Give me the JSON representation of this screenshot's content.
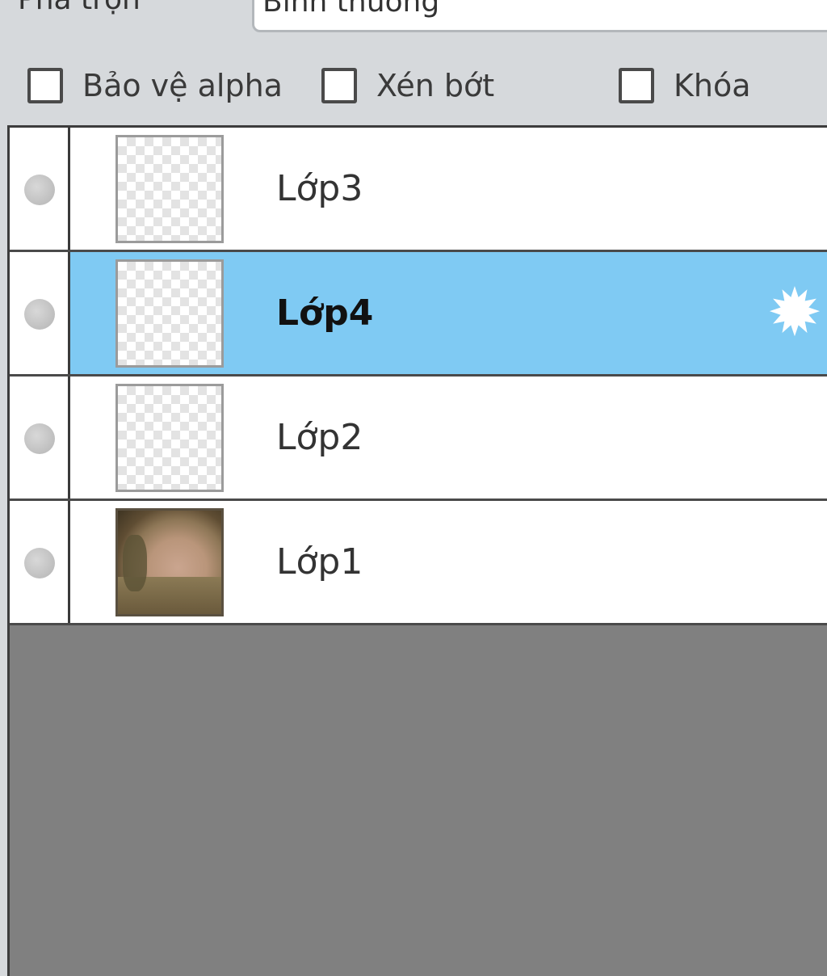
{
  "blend": {
    "label": "Pha trộn",
    "value": "Bình thường"
  },
  "options": [
    {
      "label": "Bảo vệ alpha",
      "checked": false
    },
    {
      "label": "Xén bớt",
      "checked": false
    },
    {
      "label": "Khóa",
      "checked": false
    }
  ],
  "layers": [
    {
      "name": "Lớp3",
      "selected": false,
      "thumbnail": "transparent"
    },
    {
      "name": "Lớp4",
      "selected": true,
      "thumbnail": "transparent",
      "icon": "gear-icon"
    },
    {
      "name": "Lớp2",
      "selected": false,
      "thumbnail": "transparent"
    },
    {
      "name": "Lớp1",
      "selected": false,
      "thumbnail": "photo"
    }
  ],
  "colors": {
    "selection": "#7fcaf3",
    "panel": "#d6d9dc",
    "empty_area": "#808080"
  }
}
